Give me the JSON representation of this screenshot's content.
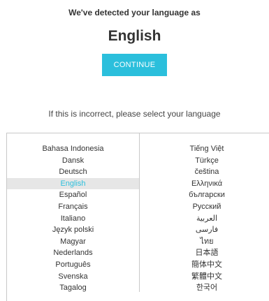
{
  "header": {
    "detected_text": "We've detected your language as",
    "detected_language": "English",
    "continue_label": "CONTINUE"
  },
  "prompt": {
    "incorrect_text": "If this is incorrect, please select your language"
  },
  "colors": {
    "accent": "#2bbfdc",
    "selected_bg": "#e6e6e6",
    "border": "#c8c8c8"
  },
  "languages": {
    "selected": "English",
    "left": [
      "Bahasa Indonesia",
      "Dansk",
      "Deutsch",
      "English",
      "Español",
      "Français",
      "Italiano",
      "Język polski",
      "Magyar",
      "Nederlands",
      "Português",
      "Svenska",
      "Tagalog"
    ],
    "right": [
      "Tiếng Việt",
      "Türkçe",
      "čeština",
      "Ελληνικά",
      "български",
      "Русский",
      "العربية",
      "فارسی",
      "ไทย",
      "日本語",
      "簡体中文",
      "繁體中文",
      "한국어"
    ]
  }
}
